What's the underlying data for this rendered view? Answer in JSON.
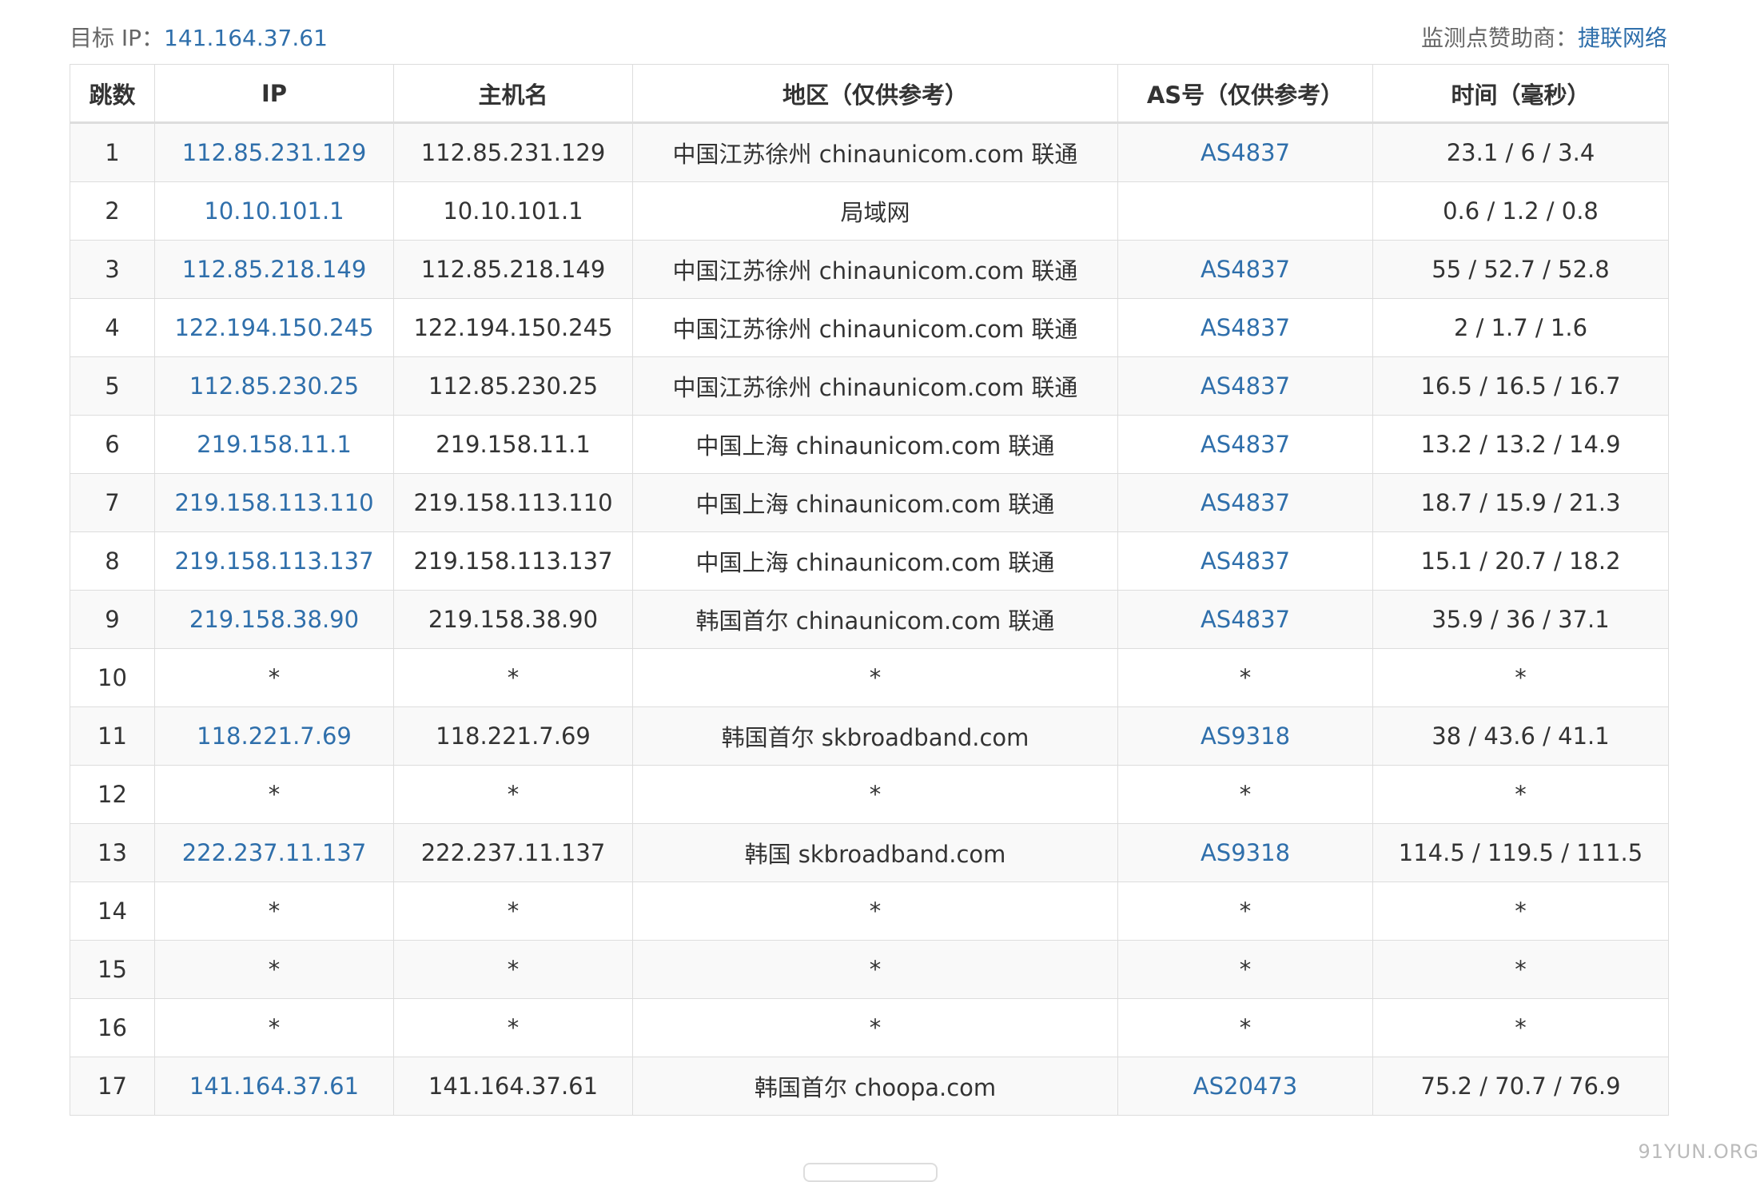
{
  "target": {
    "label": "目标 IP：",
    "ip": "141.164.37.61"
  },
  "sponsor": {
    "label": "监测点赞助商：",
    "name": "捷联网络"
  },
  "table": {
    "headers": [
      "跳数",
      "IP",
      "主机名",
      "地区（仅供参考）",
      "AS号（仅供参考）",
      "时间（毫秒）"
    ],
    "rows": [
      {
        "hop": "1",
        "ip": "112.85.231.129",
        "host": "112.85.231.129",
        "region": "中国江苏徐州 chinaunicom.com 联通",
        "as": "AS4837",
        "time": "23.1 / 6 / 3.4"
      },
      {
        "hop": "2",
        "ip": "10.10.101.1",
        "host": "10.10.101.1",
        "region": "局域网",
        "as": "",
        "time": "0.6 / 1.2 / 0.8"
      },
      {
        "hop": "3",
        "ip": "112.85.218.149",
        "host": "112.85.218.149",
        "region": "中国江苏徐州 chinaunicom.com 联通",
        "as": "AS4837",
        "time": "55 / 52.7 / 52.8"
      },
      {
        "hop": "4",
        "ip": "122.194.150.245",
        "host": "122.194.150.245",
        "region": "中国江苏徐州 chinaunicom.com 联通",
        "as": "AS4837",
        "time": "2 / 1.7 / 1.6"
      },
      {
        "hop": "5",
        "ip": "112.85.230.25",
        "host": "112.85.230.25",
        "region": "中国江苏徐州 chinaunicom.com 联通",
        "as": "AS4837",
        "time": "16.5 / 16.5 / 16.7"
      },
      {
        "hop": "6",
        "ip": "219.158.11.1",
        "host": "219.158.11.1",
        "region": "中国上海 chinaunicom.com 联通",
        "as": "AS4837",
        "time": "13.2 / 13.2 / 14.9"
      },
      {
        "hop": "7",
        "ip": "219.158.113.110",
        "host": "219.158.113.110",
        "region": "中国上海 chinaunicom.com 联通",
        "as": "AS4837",
        "time": "18.7 / 15.9 / 21.3"
      },
      {
        "hop": "8",
        "ip": "219.158.113.137",
        "host": "219.158.113.137",
        "region": "中国上海 chinaunicom.com 联通",
        "as": "AS4837",
        "time": "15.1 / 20.7 / 18.2"
      },
      {
        "hop": "9",
        "ip": "219.158.38.90",
        "host": "219.158.38.90",
        "region": "韩国首尔 chinaunicom.com 联通",
        "as": "AS4837",
        "time": "35.9 / 36 / 37.1"
      },
      {
        "hop": "10",
        "ip": "*",
        "host": "*",
        "region": "*",
        "as": "*",
        "time": "*"
      },
      {
        "hop": "11",
        "ip": "118.221.7.69",
        "host": "118.221.7.69",
        "region": "韩国首尔 skbroadband.com",
        "as": "AS9318",
        "time": "38 / 43.6 / 41.1"
      },
      {
        "hop": "12",
        "ip": "*",
        "host": "*",
        "region": "*",
        "as": "*",
        "time": "*"
      },
      {
        "hop": "13",
        "ip": "222.237.11.137",
        "host": "222.237.11.137",
        "region": "韩国 skbroadband.com",
        "as": "AS9318",
        "time": "114.5 / 119.5 / 111.5"
      },
      {
        "hop": "14",
        "ip": "*",
        "host": "*",
        "region": "*",
        "as": "*",
        "time": "*"
      },
      {
        "hop": "15",
        "ip": "*",
        "host": "*",
        "region": "*",
        "as": "*",
        "time": "*"
      },
      {
        "hop": "16",
        "ip": "*",
        "host": "*",
        "region": "*",
        "as": "*",
        "time": "*"
      },
      {
        "hop": "17",
        "ip": "141.164.37.61",
        "host": "141.164.37.61",
        "region": "韩国首尔 choopa.com",
        "as": "AS20473",
        "time": "75.2 / 70.7 / 76.9"
      }
    ]
  },
  "watermark": "91YUN.ORG",
  "colors": {
    "link": "#2f6fab",
    "border": "#dddddd",
    "stripe": "#f9f9f9"
  }
}
